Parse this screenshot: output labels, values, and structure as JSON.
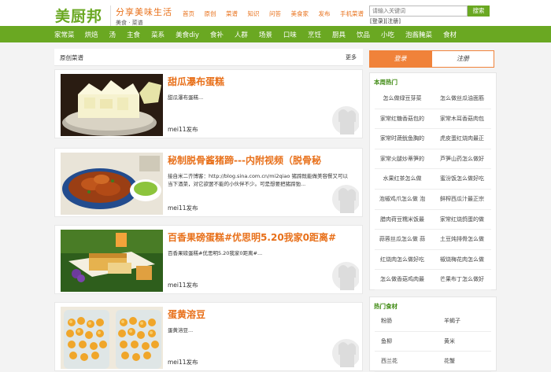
{
  "header": {
    "logo": "美厨邦",
    "slogan": "分享美味生活",
    "slogan_sub": "美食 · 菜谱",
    "nav": [
      "首页",
      "原创",
      "菜谱",
      "知识",
      "问答",
      "美食家",
      "发布",
      "手机菜谱"
    ],
    "search_placeholder": "请输入关键词",
    "search_button": "搜索",
    "login_link": "[登录]",
    "register_link": "[注册]"
  },
  "categories": [
    "家常菜",
    "烘焙",
    "汤",
    "主食",
    "菜系",
    "美食diy",
    "食补",
    "人群",
    "场景",
    "口味",
    "烹饪",
    "厨具",
    "饮品",
    "小吃",
    "泡酱腌菜",
    "食材"
  ],
  "main": {
    "title": "原创菜谱",
    "more": "更多",
    "recipes": [
      {
        "title": "甜瓜瀑布蛋糕",
        "desc": "甜瓜瀑布蛋糕...",
        "author": "mei11发布"
      },
      {
        "title": "秘制脱骨酱猪蹄---内附视频（脱骨秘",
        "desc": "接自米二齐博客：http://blog.sina.com.cn/mi2qiao 猪蹄既能做美容餐又可以当下酒菜，对它欲罢不能的小伙伴不少。可是想要把猪蹄弛...",
        "author": "mei11发布"
      },
      {
        "title": "百香果磅蛋糕#优思明5.20我家0距离#",
        "desc": "百香果磅蛋糕#优思明5.20我家0距离#...",
        "author": "mei11发布"
      },
      {
        "title": "蛋黄溶豆",
        "desc": "蛋黄溶豆...",
        "author": "mei11发布"
      }
    ]
  },
  "sidebar": {
    "tab_login": "登录",
    "tab_register": "注册",
    "hot_weekly": {
      "title": "本周热门",
      "items": [
        [
          "怎么做绿豆芽菜",
          "怎么做丝瓜油面筋"
        ],
        [
          "家常红糖香菇包的",
          "家常木耳香菇肉包"
        ],
        [
          "家常时蔬鱿鱼胸的",
          "虎皮蛋红烧肉最正"
        ],
        [
          "家常火腿炒蒂笋的",
          "芦笋山药怎么做好"
        ],
        [
          "水果红茶怎么做",
          "蜜汾饭怎么做好吃"
        ],
        [
          "泡椒鸡爪怎么做 泡",
          "鲜榨西瓜汁最正宗"
        ],
        [
          "腊肉荷豆糯米饭最",
          "家常红烧鸽蛋的做"
        ],
        [
          "蒜蓉丝瓜怎么做 蒜",
          "土豆炖排骨怎么做"
        ],
        [
          "红烧肉怎么做好吃",
          "椒烧梅花肉怎么做"
        ],
        [
          "怎么做香菇鸡肉最",
          "芒果布丁怎么做好"
        ]
      ]
    },
    "hot_ingredients": {
      "title": "热门食材",
      "items": [
        [
          "粉肠",
          "羊蝎子"
        ],
        [
          "鱼柳",
          "黄米"
        ],
        [
          "西兰花",
          "花蟹"
        ]
      ]
    }
  },
  "colors": {
    "brand_green": "#6aa822",
    "accent_orange": "#e8701a",
    "tab_orange": "#f0823a"
  }
}
